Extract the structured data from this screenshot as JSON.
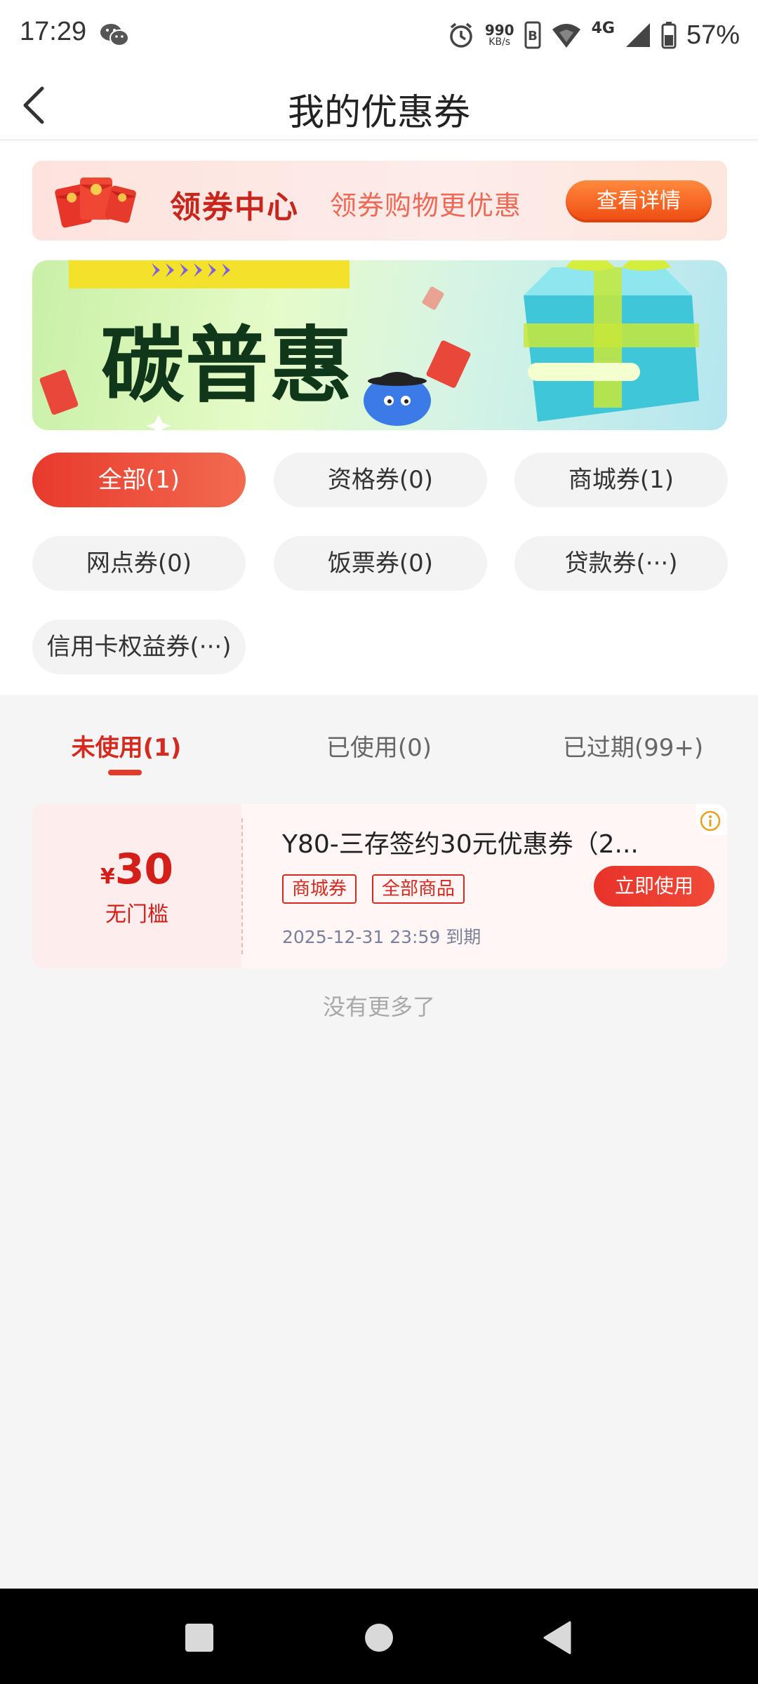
{
  "status_bar": {
    "time": "17:29",
    "net_speed_value": "990",
    "net_speed_unit": "KB/s",
    "network": "4G",
    "battery": "57%",
    "icons": [
      "wechat-icon",
      "alarm-icon",
      "hd-icon",
      "wifi-icon",
      "signal-icon",
      "battery-icon"
    ]
  },
  "nav": {
    "title": "我的优惠券",
    "back_icon": "chevron-left-icon"
  },
  "coupon_center": {
    "title": "领券中心",
    "subtitle": "领券购物更优惠",
    "button": "查看详情"
  },
  "promo_banner": {
    "text": "碳普惠"
  },
  "categories": [
    {
      "label": "全部(1)",
      "active": true
    },
    {
      "label": "资格券(0)",
      "active": false
    },
    {
      "label": "商城券(1)",
      "active": false
    },
    {
      "label": "网点券(0)",
      "active": false
    },
    {
      "label": "饭票券(0)",
      "active": false
    },
    {
      "label": "贷款券(···)",
      "active": false
    },
    {
      "label": "信用卡权益券(···)",
      "active": false
    }
  ],
  "status_tabs": [
    {
      "label": "未使用(1)",
      "active": true
    },
    {
      "label": "已使用(0)",
      "active": false
    },
    {
      "label": "已过期(99+)",
      "active": false
    }
  ],
  "coupons": [
    {
      "currency": "¥",
      "amount": "30",
      "condition": "无门槛",
      "title": "Y80-三存签约30元优惠券（2...",
      "tags": [
        "商城券",
        "全部商品"
      ],
      "expire": "2025-12-31 23:59 到期",
      "button": "立即使用"
    }
  ],
  "footer_text": "没有更多了",
  "colors": {
    "accent": "#e33a2a",
    "accent_dark": "#d42a20",
    "chip_bg": "#f3f3f3",
    "page_bg": "#f5f5f5"
  }
}
